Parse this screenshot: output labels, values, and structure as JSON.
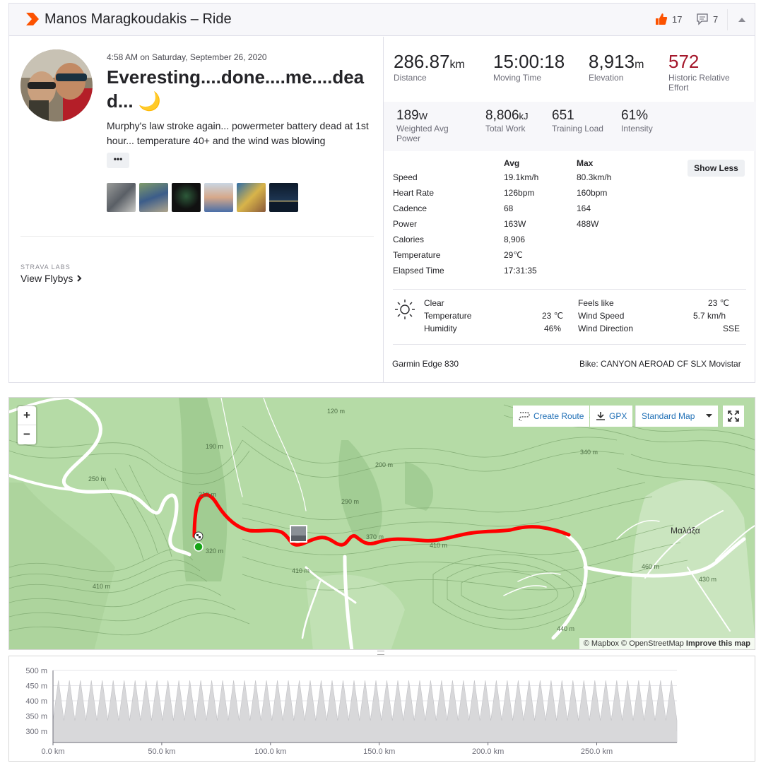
{
  "header": {
    "title": "Manos Maragkoudakis – Ride",
    "kudos_count": "17",
    "comments_count": "7"
  },
  "activity": {
    "datetime": "4:58 AM on Saturday, September 26, 2020",
    "name": "Everesting....done....me....dead... 🌙",
    "description": "Murphy's law stroke again... powermeter battery dead at 1st hour... temperature 40+ and the wind was blowing",
    "more_label": "•••",
    "photo_count": 6
  },
  "labs": {
    "label": "STRAVA LABS",
    "flyby_link": "View Flybys"
  },
  "primary_stats": [
    {
      "value": "286.87",
      "unit": "km",
      "label": "Distance"
    },
    {
      "value": "15:00:18",
      "unit": "",
      "label": "Moving Time"
    },
    {
      "value": "8,913",
      "unit": "m",
      "label": "Elevation"
    },
    {
      "value": "572",
      "unit": "",
      "label": "Historic Relative Effort"
    }
  ],
  "secondary_stats": [
    {
      "value": "189",
      "unit": "W",
      "label": "Weighted Avg Power"
    },
    {
      "value": "8,806",
      "unit": "kJ",
      "label": "Total Work"
    },
    {
      "value": "651",
      "unit": "",
      "label": "Training Load"
    },
    {
      "value": "61%",
      "unit": "",
      "label": "Intensity"
    }
  ],
  "details": {
    "col_avg": "Avg",
    "col_max": "Max",
    "show_less": "Show Less",
    "rows": [
      {
        "label": "Speed",
        "avg": "19.1km/h",
        "max": "80.3km/h"
      },
      {
        "label": "Heart Rate",
        "avg": "126bpm",
        "max": "160bpm"
      },
      {
        "label": "Cadence",
        "avg": "68",
        "max": "164"
      },
      {
        "label": "Power",
        "avg": "163W",
        "max": "488W"
      },
      {
        "label": "Calories",
        "avg": "8,906",
        "max": ""
      },
      {
        "label": "Temperature",
        "avg": "29℃",
        "max": ""
      },
      {
        "label": "Elapsed Time",
        "avg": "17:31:35",
        "max": ""
      }
    ]
  },
  "weather": {
    "condition": "Clear",
    "temperature_label": "Temperature",
    "temperature": "23 ℃",
    "humidity_label": "Humidity",
    "humidity": "46%",
    "feels_like_label": "Feels like",
    "feels_like": "23 ℃",
    "wind_speed_label": "Wind Speed",
    "wind_speed": "5.7 km/h",
    "wind_dir_label": "Wind Direction",
    "wind_dir": "SSE"
  },
  "device": {
    "device": "Garmin Edge 830",
    "bike": "Bike: CANYON AEROAD CF SLX Movistar"
  },
  "map": {
    "zoom_in": "+",
    "zoom_out": "−",
    "create_route": "Create Route",
    "gpx": "GPX",
    "map_style": "Standard Map",
    "attribution_mapbox": "© Mapbox © OpenStreetMap",
    "attribution_improve": "Improve this map",
    "place_label": "Μαλάξα",
    "contour_labels": [
      "120 m",
      "190 m",
      "250 m",
      "200 m",
      "210 m",
      "290 m",
      "320 m",
      "370 m",
      "410 m",
      "410 m",
      "410 m",
      "340 m",
      "440 m",
      "460 m",
      "430 m"
    ],
    "colors": {
      "route": "#ff0000",
      "land": "#b5dba6",
      "start": "#16a516"
    }
  },
  "elevation_profile": {
    "y_ticks": [
      "500 m",
      "450 m",
      "400 m",
      "350 m",
      "300 m"
    ],
    "x_ticks": [
      "0.0 km",
      "50.0 km",
      "100.0 km",
      "150.0 km",
      "200.0 km",
      "250.0 km"
    ],
    "repeats": 57,
    "min_elevation_m": 335,
    "max_elevation_m": 467,
    "total_km": 286.87
  }
}
